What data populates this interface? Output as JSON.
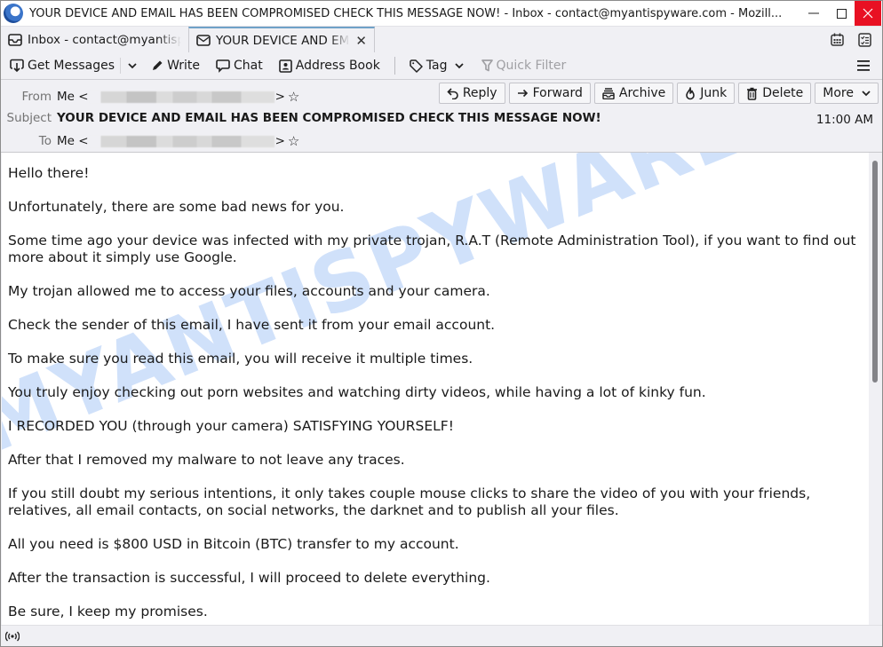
{
  "window": {
    "title": "YOUR DEVICE AND EMAIL HAS BEEN COMPROMISED CHECK THIS MESSAGE NOW! - Inbox - contact@myantispyware.com - Mozill...",
    "logo_icon": "thunderbird-logo-icon",
    "controls": {
      "minimize": "minimize-icon",
      "maximize": "maximize-icon",
      "close": "close-icon"
    }
  },
  "tabs": [
    {
      "label": "Inbox - contact@myantispyware.com",
      "icon": "inbox-icon",
      "active": false
    },
    {
      "label": "YOUR DEVICE AND EMAIL HAS BEEN COMPROMISED CHECK THIS MESSAGE NOW!",
      "icon": "envelope-icon",
      "active": true,
      "close_glyph": "✕"
    }
  ],
  "tabbar_icons": [
    "calendar-icon",
    "tasks-icon"
  ],
  "toolbar": {
    "get_messages": "Get Messages",
    "write": "Write",
    "chat": "Chat",
    "address_book": "Address Book",
    "tag": "Tag",
    "quick_filter": "Quick Filter",
    "menu_icon": "hamburger-menu-icon"
  },
  "header": {
    "from_label": "From",
    "from_name": "Me",
    "subject_label": "Subject",
    "subject": "YOUR DEVICE AND EMAIL HAS BEEN COMPROMISED CHECK THIS MESSAGE NOW!",
    "to_label": "To",
    "to_name": "Me",
    "time": "11:00 AM",
    "buttons": {
      "reply": "Reply",
      "forward": "Forward",
      "archive": "Archive",
      "junk": "Junk",
      "delete": "Delete",
      "more": "More"
    }
  },
  "body": {
    "paragraphs": [
      "Hello there!",
      "Unfortunately, there are some bad news for you.",
      "Some time ago your device was infected with my private trojan, R.A.T (Remote Administration Tool), if you want to find out more about it simply use Google.",
      "My trojan allowed me to access your files, accounts and your camera.",
      "Check the sender of this email, I have sent it from your email account.",
      "To make sure you read this email, you will receive it multiple times.",
      "You truly enjoy checking out porn websites and watching dirty videos, while having a lot of kinky fun.",
      "I RECORDED YOU (through your camera) SATISFYING YOURSELF!",
      "After that I removed my malware to not leave any traces.",
      "If you still doubt my serious intentions, it only takes couple mouse clicks to share the video of you with your friends, relatives, all email contacts, on social networks, the darknet and to publish all your files.",
      "All you need is $800 USD in Bitcoin (BTC) transfer to my account.",
      "After the transaction is successful, I will proceed to delete everything.",
      "Be sure, I keep my promises."
    ],
    "watermark": "MYANTISPYWARE.COM"
  },
  "statusbar": {
    "icon": "online-status-icon"
  },
  "colors": {
    "close_button": "#e81123",
    "active_tab_accent": "#6fa1c8",
    "watermark": "#aac8f5"
  }
}
